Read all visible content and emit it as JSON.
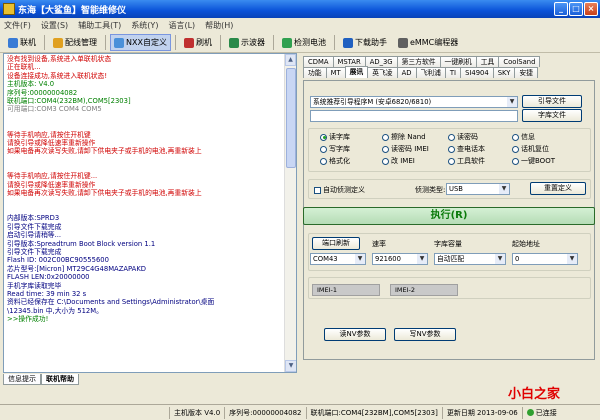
{
  "window": {
    "title": "东海【大鲨鱼】智能维修仪"
  },
  "menu": [
    "文件(F)",
    "设置(S)",
    "辅助工具(T)",
    "系统(Y)",
    "语言(L)",
    "帮助(H)"
  ],
  "toolbar": [
    "联机",
    "配线管理",
    "NXX自定义",
    "刷机",
    "示波器",
    "检测电池",
    "下载助手",
    "eMMC编程器"
  ],
  "log": {
    "lines": [
      {
        "t": "没有找到设备,系统进入单联机状态",
        "c": "#d00000"
      },
      {
        "t": "正在联机...",
        "c": "#d00000"
      },
      {
        "t": "设备连接成功,系统进入联机状态!",
        "c": "#d00000"
      },
      {
        "t": "主机版本: V4.0",
        "c": "#008000"
      },
      {
        "t": "序列号:00000004082",
        "c": "#008000"
      },
      {
        "t": "联机端口:COM4(232BM),COM5[2303]",
        "c": "#008000"
      },
      {
        "t": "可用端口:COM3 COM4 COM5",
        "c": "#808080"
      },
      {
        "t": "",
        "c": "#000"
      },
      {
        "t": "",
        "c": "#000"
      },
      {
        "t": "等待手机响应,请按住开机键",
        "c": "#d00000"
      },
      {
        "t": "请换引导或降低速率重新操作",
        "c": "#d00000"
      },
      {
        "t": "如果电备再次读写失败,请卸下供电夹子或手机的电池,再重新装上",
        "c": "#d00000"
      },
      {
        "t": "",
        "c": "#000"
      },
      {
        "t": "",
        "c": "#000"
      },
      {
        "t": "等待手机响应,请按住开机键...",
        "c": "#d00000"
      },
      {
        "t": "请换引导或降低速率重新操作",
        "c": "#d00000"
      },
      {
        "t": "如果电备再次读写失败,请卸下供电夹子或手机的电池,再重新装上",
        "c": "#d00000"
      },
      {
        "t": "",
        "c": "#000"
      },
      {
        "t": "",
        "c": "#000"
      },
      {
        "t": "内部版本:SPRD3",
        "c": "#000080"
      },
      {
        "t": "引导文件下载完成",
        "c": "#000080"
      },
      {
        "t": "启动引导请稍等...",
        "c": "#000080"
      },
      {
        "t": "引导版本:Spreadtrum Boot Block version 1.1",
        "c": "#000080"
      },
      {
        "t": "引导文件下载完成",
        "c": "#000080"
      },
      {
        "t": "Flash ID: 002C00BC90555600",
        "c": "#000080"
      },
      {
        "t": "芯片型号:[Micron] MT29C4G48MAZAPAKD",
        "c": "#000080"
      },
      {
        "t": "FLASH LEN:0x20000000",
        "c": "#000080"
      },
      {
        "t": "手机字库读取完毕",
        "c": "#000080"
      },
      {
        "t": "Read time: 39 min 32 s",
        "c": "#000080"
      },
      {
        "t": "资料已经保存在 C:\\Documents and Settings\\Administrator\\桌面",
        "c": "#000080"
      },
      {
        "t": "\\12345.bin 中,大小为 512M。",
        "c": "#000080"
      },
      {
        "t": ">>操作成功!",
        "c": "#008000"
      }
    ]
  },
  "left_tabs": [
    "信息提示",
    "联机帮助"
  ],
  "tabs_row1": [
    "CDMA",
    "MSTAR",
    "AD_3G",
    "第三方软件",
    "一键刷机",
    "工具",
    "CoolSand"
  ],
  "tabs_row2": [
    "功能",
    "MT",
    "展讯",
    "英飞凌",
    "AD",
    "飞利浦",
    "TI",
    "SI4904",
    "SKY",
    "安捷"
  ],
  "spreadtrum": {
    "loader_select": "系统推荐引导程序M (安卓6820/6810)",
    "loader_btn": "引导文件",
    "font_btn": "字库文件",
    "radios": [
      "读字库",
      "写字库",
      "格式化",
      "擦除 Nand",
      "读密码 IMEI",
      "改 IMEI",
      "读密码",
      "查电话本",
      "工具软件",
      "信息",
      "话机复位",
      "一键BOOT"
    ],
    "auto_detect": "自动侦测定义",
    "detect_type_label": "侦测类型:",
    "detect_type": "USB",
    "reset_btn": "重置定义",
    "execute": "执行(R)",
    "port_refresh": "端口刷新",
    "rate_label": "速率",
    "capacity_label": "字库容量",
    "start_addr_label": "起始地址",
    "port": "COM43",
    "rate": "921600",
    "capacity": "自动匹配",
    "start_addr": "0",
    "imei1": "IMEI-1",
    "imei2": "IMEI-2",
    "read_params": "读NV参数",
    "write_params": "写NV参数"
  },
  "status": {
    "host": "主机版本 V4.0",
    "serial": "序列号:00000004082",
    "port": "联机端口:COM4[232BM],COM5[2303]",
    "update": "更新日期 2013-09-06",
    "connected": "已连接"
  },
  "watermark": "小白之家",
  "colors": {
    "title": "#0a52d8",
    "execute_text": "#0a7a0a",
    "error": "#d00000",
    "ok": "#008000"
  }
}
